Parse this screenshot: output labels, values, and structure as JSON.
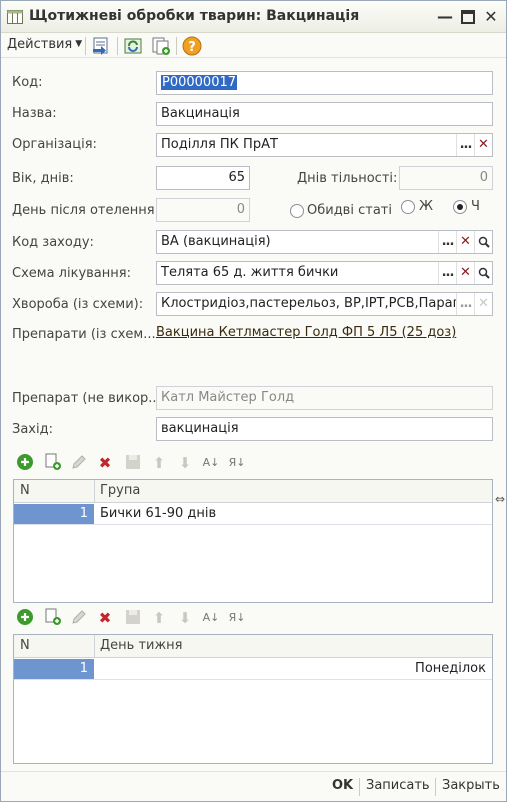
{
  "window": {
    "title": "Щотижневі обробки тварин: Вакцинація",
    "controls": [
      "minimize-icon",
      "maximize-icon",
      "close-icon"
    ]
  },
  "toolbar": {
    "actions_label": "Действия",
    "icons": [
      "post-and-close-icon",
      "refresh-icon",
      "copy-doc-icon",
      "help-icon"
    ]
  },
  "form": {
    "code": {
      "label": "Код:",
      "value": "P00000017"
    },
    "name": {
      "label": "Назва:",
      "value": "Вакцинація"
    },
    "organization": {
      "label": "Організація:",
      "value": "Поділля ПК ПрАТ"
    },
    "age": {
      "label": "Вік, днів:",
      "value": "65"
    },
    "pregnancy_days": {
      "label": "Днів тільності:",
      "value": "0"
    },
    "days_after_calving": {
      "label": "День після отелення:",
      "value": "0"
    },
    "sex_options": {
      "both": "Обидві статі",
      "female": "Ж",
      "male": "Ч",
      "selected": "male"
    },
    "measure_code": {
      "label": "Код заходу:",
      "value": "ВА (вакцинація)"
    },
    "treatment_scheme": {
      "label": "Схема лікування:",
      "value": "Телята 65 д. життя бички"
    },
    "disease": {
      "label": "Хвороба (із схеми):",
      "value": "Клостридіоз,пастерельоз, ВР,ІРТ,РСВ,Парагр"
    },
    "drugs": {
      "label": "Препарати (із схем...",
      "value": "Вакцина Кетлмастер Голд ФП 5 Л5 (25 доз)"
    },
    "drug_unused": {
      "label": "Препарат (не викор...",
      "value": "Катл Майстер Голд"
    },
    "measure": {
      "label": "Захід:",
      "value": "вакцинація"
    }
  },
  "grid_groups": {
    "columns": [
      "N",
      "Група"
    ],
    "rows": [
      {
        "n": "1",
        "value": "Бички 61-90 днів"
      }
    ]
  },
  "grid_days": {
    "columns": [
      "N",
      "День тижня"
    ],
    "rows": [
      {
        "n": "1",
        "value": "Понеділок"
      }
    ]
  },
  "bottom": {
    "ok": "OK",
    "save": "Записать",
    "close": "Закрыть"
  },
  "colors": {
    "accent_row": "#6e95cf",
    "selection": "#316ac5",
    "delete_red": "#c0272d",
    "add_green": "#3c9b2c"
  }
}
